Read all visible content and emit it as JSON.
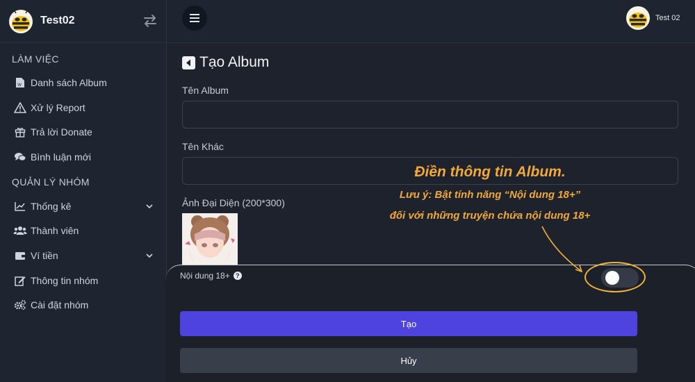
{
  "brand": {
    "name": "Test02"
  },
  "sidebar": {
    "section_work": "LÀM VIỆC",
    "section_group": "QUẢN LÝ NHÓM",
    "items": [
      {
        "label": "Danh sách Album",
        "icon": "word-file-icon"
      },
      {
        "label": "Xử lý Report",
        "icon": "warning-triangle-icon"
      },
      {
        "label": "Trả lời Donate",
        "icon": "gift-icon"
      },
      {
        "label": "Bình luận mới",
        "icon": "comments-icon"
      },
      {
        "label": "Thống kê",
        "icon": "line-chart-icon",
        "has_dropdown": true
      },
      {
        "label": "Thành viên",
        "icon": "users-icon"
      },
      {
        "label": "Ví tiền",
        "icon": "wallet-icon",
        "has_dropdown": true
      },
      {
        "label": "Thông tin nhóm",
        "icon": "edit-icon"
      },
      {
        "label": "Cài đặt nhóm",
        "icon": "gears-icon"
      }
    ]
  },
  "topbar": {
    "user_name": "Test 02"
  },
  "page": {
    "title": "Tạo Album",
    "fields": {
      "album_name_label": "Tên Album",
      "album_name_value": "",
      "other_name_label": "Tên Khác",
      "other_name_value": "",
      "cover_label": "Ảnh Đại Diện (200*300)"
    }
  },
  "sheet": {
    "nsfw_label": "Nội dung 18+",
    "nsfw_enabled": false,
    "create_label": "Tạo",
    "cancel_label": "Hủy"
  },
  "annotation": {
    "title": "Điền thông tin Album.",
    "line1": "Lưu ý: Bật tính năng “Nội dung 18+”",
    "line2": "đối với những truyện chứa nội dung 18+"
  },
  "colors": {
    "background": "#1d222c",
    "sidebar": "#1f2530",
    "primary_button": "#4e43df",
    "secondary_button": "#383e4a",
    "annotation": "#f3a93a"
  }
}
